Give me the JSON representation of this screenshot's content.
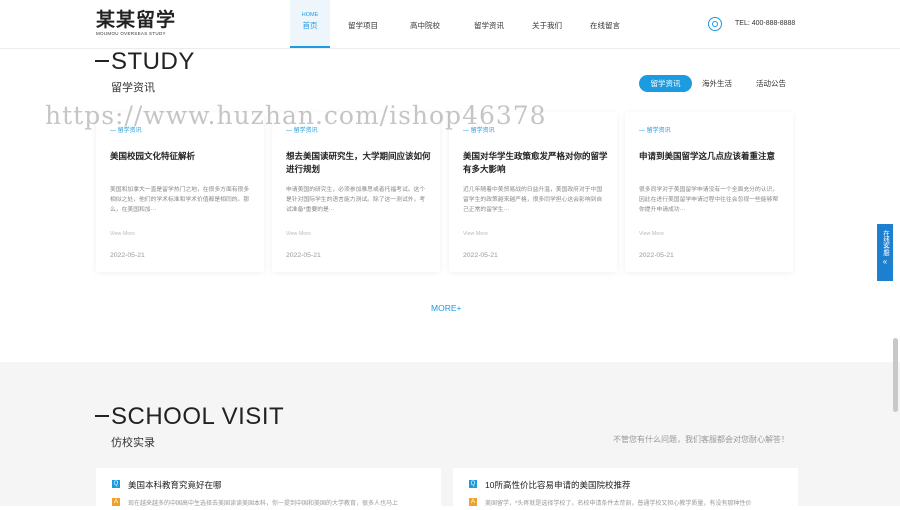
{
  "header": {
    "logo_main": "某某留学",
    "logo_sub": "MOUMOU OVERSEAS STUDY",
    "nav": [
      {
        "en": "HOME",
        "label": "首页"
      },
      {
        "label": "留学项目"
      },
      {
        "label": "高中院校"
      },
      {
        "label": "留学资讯"
      },
      {
        "label": "关于我们"
      },
      {
        "label": "在线留言"
      }
    ],
    "tel": "TEL: 400-888-8888"
  },
  "study": {
    "title": "STUDY",
    "subtitle": "留学资讯",
    "tabs": [
      "留学资讯",
      "海外生活",
      "活动公告"
    ],
    "cards": [
      {
        "category": "— 留学资讯",
        "title": "美国校园文化特征解析",
        "desc": "美国和加拿大一直是留学热门之地，在很多方面有很多相似之处，他们的学术标准和学术价值都是相同的。那么，在美国和加···",
        "more": "View More",
        "date": "2022-05-21"
      },
      {
        "category": "— 留学资讯",
        "title": "想去美国读研究生，大学期间应该如何进行规划",
        "desc": "申请美国的研究生，必须参加雅思或者托福考试。这个是针对国际学生的语言能力测试。除了这一测试外，考试准备*重要的是···",
        "more": "View More",
        "date": "2022-05-21"
      },
      {
        "category": "— 留学资讯",
        "title": "美国对华学生政策愈发严格对你的留学有多大影响",
        "desc": "近几年随着中美贸易战的日益升温，美国政府对于中国留学生的政策越来越严格，很多同学担心这会影响到自己正常的留学生···",
        "more": "View More",
        "date": "2022-05-21"
      },
      {
        "category": "— 留学资讯",
        "title": "申请到美国留学这几点应该着重注意",
        "desc": "很多同学对于美国留学申请没有一个全面充分的认识，因此在进行美国留学申请过程中往往会忽视一些能够帮你提升申请成功···",
        "more": "View More",
        "date": "2022-05-21"
      }
    ],
    "more": "MORE+"
  },
  "watermark": "https://www.huzhan.com/ishop46378",
  "visit": {
    "title": "SCHOOL VISIT",
    "subtitle": "仿校实录",
    "right_text": "不管您有什么问题，我们客服都会对您耐心解答！",
    "items": [
      {
        "q_icon": "Q",
        "a_icon": "A",
        "question": "美国本科教育究竟好在哪",
        "answer": "现在越来越多的中国高中生选择去美国读读美国本科，你一提到中国和美国的大学教育，很多人也马上"
      },
      {
        "q_icon": "Q",
        "a_icon": "A",
        "question": "10所高性价比容易申请的美国院校推荐",
        "answer": "美国留学，*头疼就是选择学校了，名校申请条件太苛刻，普通学校又担心教学质量，有没有那种性价"
      }
    ]
  },
  "side": {
    "label": "在线客服"
  },
  "colors": {
    "accent": "#1d9be0",
    "side_button": "#1d7fd0",
    "answer_icon": "#f0a030"
  }
}
